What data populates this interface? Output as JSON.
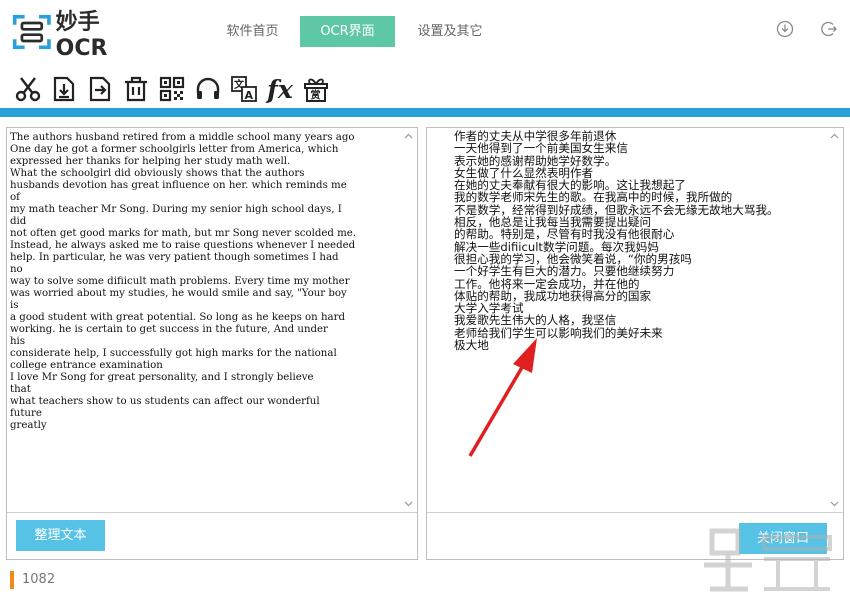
{
  "header": {
    "logo_text": "妙手OCR",
    "tabs": [
      {
        "label": "软件首页"
      },
      {
        "label": "OCR界面"
      },
      {
        "label": "设置及其它"
      }
    ],
    "active_tab_color": "#5ec7a6"
  },
  "toolbar": {
    "icons": [
      "scissors-icon",
      "import-icon",
      "export-icon",
      "trash-icon",
      "qrcode-icon",
      "headset-icon",
      "translate-icon",
      "formula-icon",
      "gift-reward-icon"
    ],
    "formula_label": "fx",
    "reward_label": "赏",
    "accent_color": "#2b9fd8"
  },
  "left_pane": {
    "text": "The authors husband retired from a middle school many years ago\nOne day he got a former schoolgirls letter from America, which\nexpressed her thanks for helping her study math well.\nWhat the schoolgirl did obviously shows that the authors\nhusbands devotion has great influence on her. which reminds me\nof\nmy math teacher Mr Song. During my senior high school days, I\ndid\nnot often get good marks for math, but mr Song never scolded me.\nInstead, he always asked me to raise questions whenever I needed\nhelp. In particular, he was very patient though sometimes I had\nno\nway to solve some difiicult math problems. Every time my mother\nwas worried about my studies, he would smile and say, \"Your boy\nis\na good student with great potential. So long as he keeps on hard\nworking. he is certain to get success in the future, And under\nhis\nconsiderate help, I successfully got high marks for the national\ncollege entrance examination\nI love Mr Song for great personality, and I strongly believe\nthat\nwhat teachers show to us students can affect our wonderful\nfuture\ngreatly",
    "button_label": "整理文本"
  },
  "right_pane": {
    "text": "作者的丈夫从中学很多年前退休\n一天他得到了一个前美国女生来信\n表示她的感谢帮助她学好数学。\n女生做了什么显然表明作者\n在她的丈夫奉献有很大的影响。这让我想起了\n我的数学老师宋先生的歌。在我高中的时候，我所做的\n不是数学，经常得到好成绩，但歌永远不会无缘无故地大骂我。\n相反，他总是让我每当我需要提出疑问\n的帮助。特别是，尽管有时我没有他很耐心\n解决一些difiicult数学问题。每次我妈妈\n很担心我的学习，他会微笑着说，“你的男孩吗\n一个好学生有巨大的潜力。只要他继续努力\n工作。他将来一定会成功，并在他的\n体贴的帮助，我成功地获得高分的国家\n大学入学考试\n我爱歌先生伟大的人格，我坚信\n老师给我们学生可以影响我们的美好未来\n极大地",
    "button_label": "关闭窗口"
  },
  "status": {
    "count": "1082"
  },
  "annotation": {
    "arrow_color": "#e02020"
  }
}
